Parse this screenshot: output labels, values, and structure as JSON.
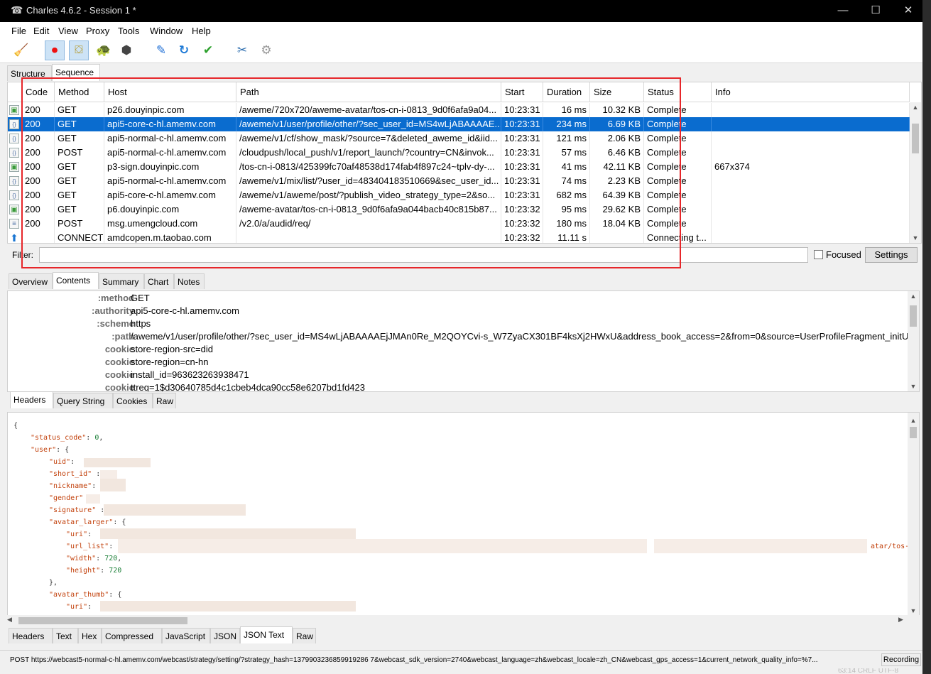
{
  "window": {
    "title": "Charles 4.6.2 - Session 1 *",
    "controls": {
      "minimize": "—",
      "maximize": "☐",
      "close": "✕"
    }
  },
  "menu": [
    "File",
    "Edit",
    "View",
    "Proxy",
    "Tools",
    "Window",
    "Help"
  ],
  "toolbar": [
    {
      "icon": "broom-icon",
      "glyph": "🧹"
    },
    {
      "icon": "record-icon",
      "glyph": "⏺",
      "active": true
    },
    {
      "icon": "throttle-icon",
      "glyph": "⛋",
      "active": true
    },
    {
      "icon": "turtle-icon",
      "glyph": "🐢"
    },
    {
      "icon": "stop-hexagon-icon",
      "glyph": "⬢"
    },
    {
      "icon": "pen-icon",
      "glyph": "✎"
    },
    {
      "icon": "refresh-icon",
      "glyph": "↻"
    },
    {
      "icon": "check-icon",
      "glyph": "✔"
    },
    {
      "icon": "tools-icon",
      "glyph": "✂"
    },
    {
      "icon": "settings-gear-icon",
      "glyph": "⚙"
    }
  ],
  "view_tabs": {
    "structure": "Structure",
    "sequence": "Sequence"
  },
  "columns": [
    "Code",
    "Method",
    "Host",
    "Path",
    "Start",
    "Duration",
    "Size",
    "Status",
    "Info"
  ],
  "rows": [
    {
      "kind": "image",
      "code": "200",
      "method": "GET",
      "host": "p26.douyinpic.com",
      "path": "/aweme/720x720/aweme-avatar/tos-cn-i-0813_9d0f6afa9a04...",
      "start": "10:23:31",
      "duration": "16 ms",
      "size": "10.32 KB",
      "status": "Complete",
      "info": ""
    },
    {
      "kind": "json",
      "code": "200",
      "method": "GET",
      "host": "api5-core-c-hl.amemv.com",
      "path": "/aweme/v1/user/profile/other/?sec_user_id=MS4wLjABAAAAE...",
      "start": "10:23:31",
      "duration": "234 ms",
      "size": "6.69 KB",
      "status": "Complete",
      "info": "",
      "selected": true
    },
    {
      "kind": "json",
      "code": "200",
      "method": "GET",
      "host": "api5-normal-c-hl.amemv.com",
      "path": "/aweme/v1/cf/show_mask/?source=7&deleted_aweme_id&iid...",
      "start": "10:23:31",
      "duration": "121 ms",
      "size": "2.06 KB",
      "status": "Complete",
      "info": ""
    },
    {
      "kind": "json",
      "code": "200",
      "method": "POST",
      "host": "api5-normal-c-hl.amemv.com",
      "path": "/cloudpush/local_push/v1/report_launch/?country=CN&invok...",
      "start": "10:23:31",
      "duration": "57 ms",
      "size": "6.46 KB",
      "status": "Complete",
      "info": ""
    },
    {
      "kind": "image",
      "code": "200",
      "method": "GET",
      "host": "p3-sign.douyinpic.com",
      "path": "/tos-cn-i-0813/425399fc70af48538d174fab4f897c24~tplv-dy-...",
      "start": "10:23:31",
      "duration": "41 ms",
      "size": "42.11 KB",
      "status": "Complete",
      "info": "667x374"
    },
    {
      "kind": "json",
      "code": "200",
      "method": "GET",
      "host": "api5-normal-c-hl.amemv.com",
      "path": "/aweme/v1/mix/list/?user_id=483404183510669&sec_user_id...",
      "start": "10:23:31",
      "duration": "74 ms",
      "size": "2.23 KB",
      "status": "Complete",
      "info": ""
    },
    {
      "kind": "json",
      "code": "200",
      "method": "GET",
      "host": "api5-core-c-hl.amemv.com",
      "path": "/aweme/v1/aweme/post/?publish_video_strategy_type=2&so...",
      "start": "10:23:31",
      "duration": "682 ms",
      "size": "64.39 KB",
      "status": "Complete",
      "info": ""
    },
    {
      "kind": "image",
      "code": "200",
      "method": "GET",
      "host": "p6.douyinpic.com",
      "path": "/aweme-avatar/tos-cn-i-0813_9d0f6afa9a044bacb40c815b87...",
      "start": "10:23:32",
      "duration": "95 ms",
      "size": "29.62 KB",
      "status": "Complete",
      "info": ""
    },
    {
      "kind": "doc",
      "code": "200",
      "method": "POST",
      "host": "msg.umengcloud.com",
      "path": "/v2.0/a/audid/req/",
      "start": "10:23:32",
      "duration": "180 ms",
      "size": "18.04 KB",
      "status": "Complete",
      "info": ""
    },
    {
      "kind": "connect",
      "code": "",
      "method": "CONNECT",
      "host": "amdcopen.m.taobao.com",
      "path": "",
      "start": "10:23:32",
      "duration": "11.11 s",
      "size": "",
      "status": "Connecting t...",
      "info": ""
    }
  ],
  "filter": {
    "label": "Filter:",
    "value": "",
    "focused_label": "Focused",
    "settings_label": "Settings"
  },
  "detail_tabs": [
    "Overview",
    "Contents",
    "Summary",
    "Chart",
    "Notes"
  ],
  "headers": [
    {
      "key": ":method",
      "value": "GET"
    },
    {
      "key": ":authority",
      "value": "api5-core-c-hl.amemv.com"
    },
    {
      "key": ":scheme",
      "value": "https"
    },
    {
      "key": ":path",
      "value": "/aweme/v1/user/profile/other/?sec_user_id=MS4wLjABAAAAEjJMAn0Re_M2QOYCvi-s_W7ZyaCX301BF4ksXj2HWxU&address_book_access=2&from=0&source=UserProfileFragment_initU..."
    },
    {
      "key": "cookie",
      "value": "store-region-src=did"
    },
    {
      "key": "cookie",
      "value": "store-region=cn-hn"
    },
    {
      "key": "cookie",
      "value": "install_id=963623263938471"
    },
    {
      "key": "cookie",
      "value": "ttreq=1$d30640785d4c1cbeb4dca90cc58e6207bd1fd423"
    }
  ],
  "request_tabs": [
    "Headers",
    "Query String",
    "Cookies",
    "Raw"
  ],
  "json_lines": {
    "l0": "{",
    "status_code_key": "\"status_code\"",
    "status_code_val": "0",
    "user_key": "\"user\"",
    "uid_key": "\"uid\"",
    "short_id_key": "\"short_id\"",
    "nickname_key": "\"nickname\"",
    "gender_key": "\"gender\"",
    "signature_key": "\"signature\"",
    "avatar_larger_key": "\"avatar_larger\"",
    "uri_key": "\"uri\"",
    "url_list_key": "\"url_list\"",
    "url_tail": "atar/tos-c",
    "width_key": "\"width\"",
    "width_val": "720",
    "height_key": "\"height\"",
    "height_val": "720",
    "close_obj": "},",
    "avatar_thumb_key": "\"avatar_thumb\"",
    "uri2_key": "\"uri\""
  },
  "response_tabs": [
    "Headers",
    "Text",
    "Hex",
    "Compressed",
    "JavaScript",
    "JSON",
    "JSON Text",
    "Raw"
  ],
  "statusbar": {
    "text": "POST https://webcast5-normal-c-hl.amemv.com/webcast/strategy/setting/?strategy_hash=1379903236859919286 7&webcast_sdk_version=2740&webcast_language=zh&webcast_locale=zh_CN&webcast_gps_access=1&current_network_quality_info=%7...",
    "recording": "Recording"
  },
  "background_text": "63:14   CRLF   UTF-8"
}
